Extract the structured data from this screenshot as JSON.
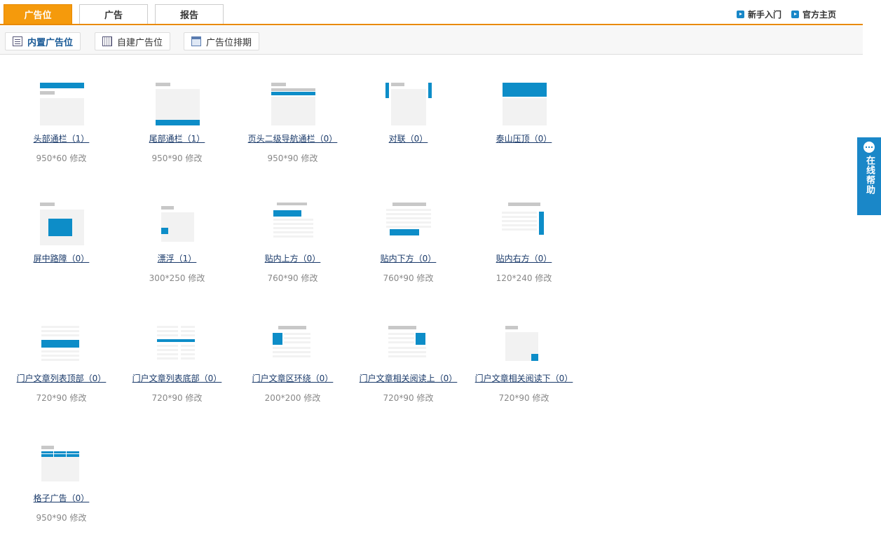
{
  "top_tabs": [
    {
      "label": "广告位",
      "active": true
    },
    {
      "label": "广告",
      "active": false
    },
    {
      "label": "报告",
      "active": false
    }
  ],
  "top_links": [
    {
      "label": "新手入门",
      "icon": "play-arrow-icon"
    },
    {
      "label": "官方主页",
      "icon": "play-arrow-icon"
    }
  ],
  "sub_tabs": [
    {
      "label": "内置广告位",
      "icon": "document-list-icon",
      "active": true
    },
    {
      "label": "自建广告位",
      "icon": "grid-sheet-icon",
      "active": false
    },
    {
      "label": "广告位排期",
      "icon": "calendar-icon",
      "active": false
    }
  ],
  "slots": [
    {
      "name": "头部通栏（1）",
      "size": "950*60",
      "edit": "修改"
    },
    {
      "name": "尾部通栏（1）",
      "size": "950*90",
      "edit": "修改"
    },
    {
      "name": "页头二级导航通栏（0）",
      "size": "950*90",
      "edit": "修改"
    },
    {
      "name": "对联（0）",
      "size": "",
      "edit": ""
    },
    {
      "name": "泰山压顶（0）",
      "size": "",
      "edit": ""
    },
    {
      "name": "屏中路障（0）",
      "size": "",
      "edit": ""
    },
    {
      "name": "漂浮（1）",
      "size": "300*250",
      "edit": "修改"
    },
    {
      "name": "贴内上方（0）",
      "size": "760*90",
      "edit": "修改"
    },
    {
      "name": "贴内下方（0）",
      "size": "760*90",
      "edit": "修改"
    },
    {
      "name": "贴内右方（0）",
      "size": "120*240",
      "edit": "修改"
    },
    {
      "name": "门户文章列表顶部（0）",
      "size": "720*90",
      "edit": "修改"
    },
    {
      "name": "门户文章列表底部（0）",
      "size": "720*90",
      "edit": "修改"
    },
    {
      "name": "门户文章区环绕（0）",
      "size": "200*200",
      "edit": "修改"
    },
    {
      "name": "门户文章相关阅读上（0）",
      "size": "720*90",
      "edit": "修改"
    },
    {
      "name": "门户文章相关阅读下（0）",
      "size": "720*90",
      "edit": "修改"
    },
    {
      "name": "格子广告（0）",
      "size": "950*90",
      "edit": "修改"
    }
  ],
  "help": {
    "label": "在线帮助",
    "icon": "chat-bubble-icon"
  },
  "colors": {
    "accent_orange": "#f59a0c",
    "slot_blue": "#0d8dc8",
    "help_blue": "#1a87c8",
    "link": "#1a3a6a"
  }
}
